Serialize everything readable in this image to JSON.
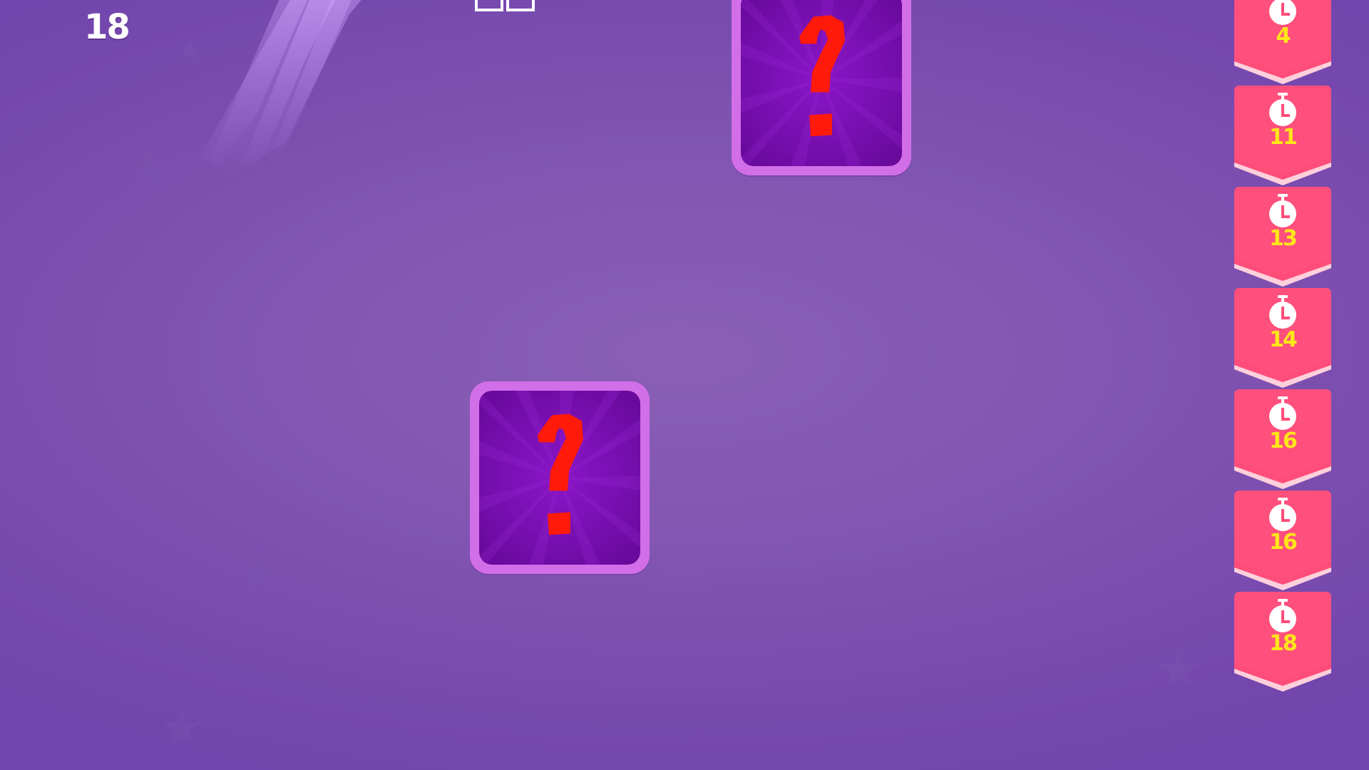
{
  "hud": {
    "score": "18"
  },
  "cards": [
    {
      "symbol": "?",
      "state": "face-down",
      "icon": "question-mark-icon"
    },
    {
      "symbol": "?",
      "state": "face-down",
      "icon": "question-mark-icon"
    }
  ],
  "timers": [
    {
      "value": "4",
      "icon": "stopwatch-icon"
    },
    {
      "value": "11",
      "icon": "stopwatch-icon"
    },
    {
      "value": "13",
      "icon": "stopwatch-icon"
    },
    {
      "value": "14",
      "icon": "stopwatch-icon"
    },
    {
      "value": "16",
      "icon": "stopwatch-icon"
    },
    {
      "value": "16",
      "icon": "stopwatch-icon"
    },
    {
      "value": "18",
      "icon": "stopwatch-icon"
    }
  ],
  "colors": {
    "background": "#7f52b1",
    "card_border": "#d26ee8",
    "card_face": "#7a10b4",
    "question_mark": "#ff1a0a",
    "timer_banner": "#ff4d7a",
    "timer_text": "#ffe61a",
    "score_text": "#ffffff"
  }
}
